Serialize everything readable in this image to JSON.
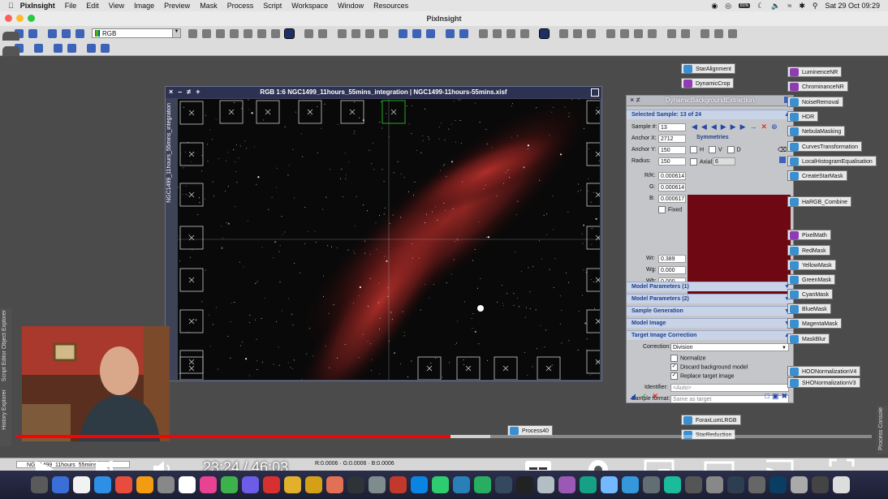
{
  "menubar": {
    "app": "PixInsight",
    "items": [
      "File",
      "Edit",
      "View",
      "Image",
      "Preview",
      "Mask",
      "Process",
      "Script",
      "Workspace",
      "Window",
      "Resources"
    ],
    "battery": "81%",
    "datetime": "Sat 29 Oct  09:29"
  },
  "window": {
    "title": "PixInsight"
  },
  "toolbar": {
    "rgb_mode": "RGB"
  },
  "image_window": {
    "title": "RGB 1:6 NGC1499_11hours_55mins_integration | NGC1499-11hours-55mins.xisf",
    "side_label": "NGC1499_11hours_55mins_integration"
  },
  "dbe": {
    "title": "DynamicBackgroundExtraction",
    "selected_samples": "Selected Sample: 13 of 24",
    "sample_label": "Sample #:",
    "sample_value": "13",
    "anchor_x_label": "Anchor X:",
    "anchor_x": "2712",
    "anchor_y_label": "Anchor Y:",
    "anchor_y": "150",
    "radius_label": "Radius:",
    "radius": "150",
    "symmetries": "Symmetries",
    "sym_h": "H",
    "sym_v": "V",
    "sym_d": "D",
    "axial_label": "Axial:",
    "axial_value": "6",
    "rk_label": "R/K:",
    "rk": "0.000614",
    "g_label": "G:",
    "g": "0.000614",
    "b_label": "B:",
    "b": "0.000617",
    "fixed": "Fixed",
    "wr_label": "Wr:",
    "wr": "0.389",
    "wg_label": "Wg:",
    "wg": "0.000",
    "wb_label": "Wb:",
    "wb": "0.000",
    "sections": [
      "Model Parameters (1)",
      "Model Parameters (2)",
      "Sample Generation",
      "Model Image",
      "Target Image Correction"
    ],
    "correction_label": "Correction:",
    "correction": "Division",
    "normalize": "Normalize",
    "discard_bg": "Discard background model",
    "replace_target": "Replace target image",
    "identifier_label": "Identifier:",
    "identifier": "<Auto>",
    "sample_format_label": "Sample format:",
    "sample_format": "Same as target"
  },
  "process_icons_left": [
    "StarAlignment",
    "DynamicCrop",
    "StarReduction",
    "ForaxLumLRGB"
  ],
  "process_icons_right": [
    "LuminenceNR",
    "ChrominanceNR",
    "NoiseRemoval",
    "HDR",
    "NebulaMasking",
    "CurvesTransformation",
    "LocalHistogramEqualisation",
    "CreateStarMask",
    "HaRGB_Combine",
    "PixelMath",
    "RedMask",
    "YellowMask",
    "GreenMask",
    "CyanMask",
    "BlueMask",
    "MagentaMask",
    "MaskBlur",
    "HOONormalizationV4",
    "SHONormalizationV3"
  ],
  "process40": "Process40",
  "side_tabs": [
    "History Explorer",
    "Script Editor",
    "Object Explorer"
  ],
  "right_tab": "Process Console",
  "statusbar": {
    "view": "NGC1499_11hours_55mins",
    "readout": "R:0.0006 · G:0.0006 · B:0.0006"
  },
  "video": {
    "time": "23:24 / 46:03",
    "progress_fraction": 0.508
  },
  "colors": {
    "accent": "#2346a8",
    "progress": "#ff0000"
  }
}
